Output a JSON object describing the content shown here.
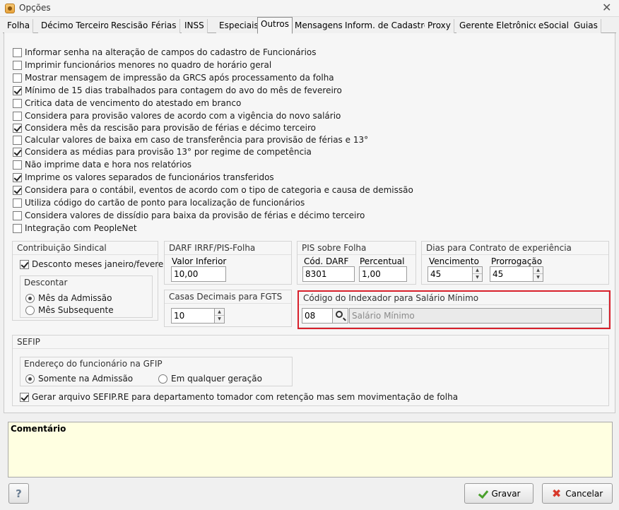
{
  "window": {
    "title": "Opções",
    "close": "✕"
  },
  "tabs": [
    "Folha",
    "Décimo Terceiro",
    "Rescisão",
    "Férias",
    "INSS",
    "Especiais",
    "Outros",
    "Mensagens",
    "Inform. de Cadastro",
    "Proxy",
    "Gerente Eletrônico",
    "eSocial",
    "Guias"
  ],
  "active_tab": "Outros",
  "options": [
    {
      "label": "Informar senha na alteração de campos do cadastro de Funcionários",
      "checked": false
    },
    {
      "label": "Imprimir funcionários menores no quadro de horário geral",
      "checked": false
    },
    {
      "label": "Mostrar mensagem de impressão da GRCS após processamento da folha",
      "checked": false
    },
    {
      "label": "Mínimo de 15 dias trabalhados para contagem do avo do mês de fevereiro",
      "checked": true
    },
    {
      "label": "Critica data de vencimento do atestado em branco",
      "checked": false
    },
    {
      "label": "Considera para provisão valores de acordo com a vigência do novo salário",
      "checked": false
    },
    {
      "label": "Considera mês da rescisão para provisão de férias e décimo terceiro",
      "checked": true
    },
    {
      "label": "Calcular valores de baixa em caso de transferência para provisão de férias e 13°",
      "checked": false
    },
    {
      "label": "Considera as médias para provisão 13° por regime de competência",
      "checked": true
    },
    {
      "label": "Não imprime data e hora nos relatórios",
      "checked": false
    },
    {
      "label": "Imprime os valores separados de funcionários transferidos",
      "checked": true
    },
    {
      "label": "Considera para o contábil, eventos de acordo com o tipo de categoria e causa de demissão",
      "checked": true
    },
    {
      "label": "Utiliza código do cartão de ponto para localização de funcionários",
      "checked": false
    },
    {
      "label": "Considera valores de dissídio para baixa da provisão de férias e décimo terceiro",
      "checked": false
    },
    {
      "label": "Integração com PeopleNet",
      "checked": false
    }
  ],
  "contribuicao": {
    "title": "Contribuição Sindical",
    "desconto_label": "Desconto meses janeiro/fevereiro",
    "desconto_checked": true,
    "descontar": {
      "title": "Descontar",
      "options": [
        "Mês da Admissão",
        "Mês Subsequente"
      ],
      "selected": 0
    }
  },
  "darf": {
    "title": "DARF IRRF/PIS-Folha",
    "label": "Valor Inferior",
    "value": "10,00"
  },
  "casas": {
    "title": "Casas Decimais para FGTS",
    "value": "10"
  },
  "pis": {
    "title": "PIS sobre Folha",
    "cod_label": "Cód. DARF",
    "cod_value": "8301",
    "perc_label": "Percentual",
    "perc_value": "1,00"
  },
  "dias": {
    "title": "Dias para Contrato de experiência",
    "venc_label": "Vencimento",
    "venc_value": "45",
    "prorr_label": "Prorrogação",
    "prorr_value": "45"
  },
  "indexador": {
    "title": "Código do Indexador para Salário Mínimo",
    "code": "08",
    "description": "Salário Mínimo"
  },
  "sefip": {
    "title": "SEFIP",
    "endereco_title": "Endereço do funcionário na GFIP",
    "options": [
      "Somente na Admissão",
      "Em qualquer geração"
    ],
    "selected": 0,
    "gerar_label": "Gerar arquivo SEFIP.RE para departamento tomador com retenção mas sem movimentação de folha",
    "gerar_checked": true
  },
  "comment": {
    "label": "Comentário"
  },
  "buttons": {
    "help": "?",
    "save": "Gravar",
    "cancel": "Cancelar"
  },
  "colors": {
    "highlight": "#d8202b",
    "comment_bg": "#ffffe1"
  }
}
